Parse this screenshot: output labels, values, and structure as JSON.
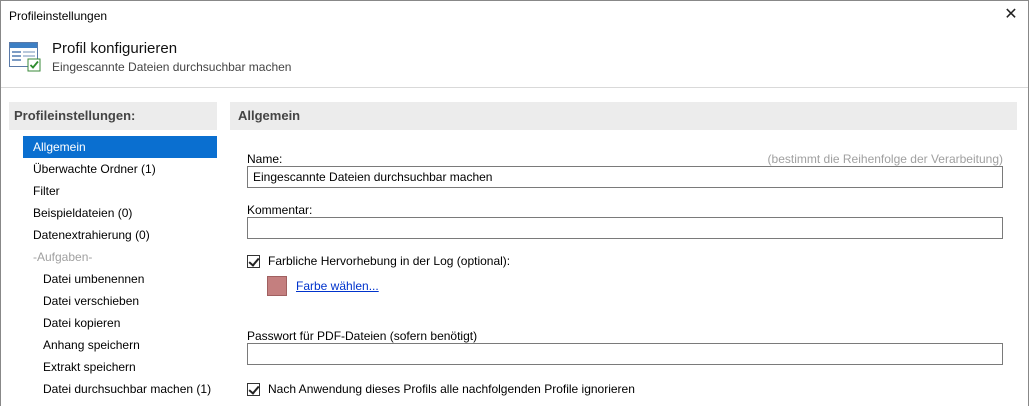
{
  "window": {
    "title": "Profileinstellungen",
    "close_glyph": "✕"
  },
  "header": {
    "title": "Profil konfigurieren",
    "subtitle": "Eingescannte Dateien durchsuchbar machen",
    "icon": "settings-window-icon"
  },
  "left": {
    "heading": "Profileinstellungen:",
    "items": [
      {
        "label": "Allgemein",
        "selected": true
      },
      {
        "label": "Überwachte Ordner (1)"
      },
      {
        "label": "Filter"
      },
      {
        "label": "Beispieldateien (0)"
      },
      {
        "label": "Datenextrahierung (0)"
      }
    ],
    "group_label": "-Aufgaben-",
    "tasks": [
      {
        "label": "Datei umbenennen"
      },
      {
        "label": "Datei verschieben"
      },
      {
        "label": "Datei kopieren"
      },
      {
        "label": "Anhang speichern"
      },
      {
        "label": "Extrakt speichern"
      },
      {
        "label": "Datei durchsuchbar machen (1)"
      }
    ]
  },
  "main": {
    "heading": "Allgemein",
    "name_label": "Name:",
    "name_hint": "(bestimmt die Reihenfolge der Verarbeitung)",
    "name_value": "Eingescannte Dateien durchsuchbar machen",
    "comment_label": "Kommentar:",
    "comment_value": "",
    "highlight_label": "Farbliche Hervorhebung in der Log (optional):",
    "highlight_checked": true,
    "swatch_color": "#c47f7f",
    "color_link": "Farbe wählen...",
    "password_label": "Passwort für PDF-Dateien (sofern benötigt)",
    "password_value": "",
    "ignore_label": "Nach Anwendung dieses Profils alle nachfolgenden Profile ignorieren",
    "ignore_checked": true
  }
}
